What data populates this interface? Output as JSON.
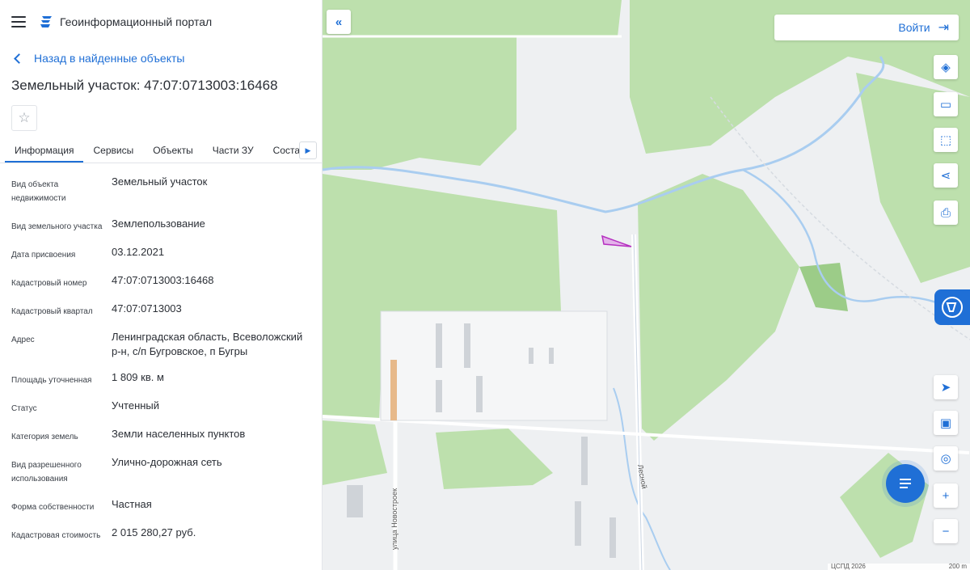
{
  "header": {
    "app_title": "Геоинформационный портал"
  },
  "nav": {
    "back_label": "Назад в найденные объекты"
  },
  "object": {
    "title": "Земельный участок: 47:07:0713003:16468"
  },
  "tabs": [
    {
      "label": "Информация",
      "active": true
    },
    {
      "label": "Сервисы"
    },
    {
      "label": "Объекты"
    },
    {
      "label": "Части ЗУ"
    },
    {
      "label": "Соста"
    }
  ],
  "properties": [
    {
      "label": "Вид объекта недвижимости",
      "value": "Земельный участок"
    },
    {
      "label": "Вид земельного участка",
      "value": "Землепользование"
    },
    {
      "label": "Дата присвоения",
      "value": "03.12.2021"
    },
    {
      "label": "Кадастровый номер",
      "value": "47:07:0713003:16468"
    },
    {
      "label": "Кадастровый квартал",
      "value": "47:07:0713003"
    },
    {
      "label": "Адрес",
      "value": "Ленинградская область, Всеволожский р-н, с/п Бугровское, п Бугры"
    },
    {
      "label": "Площадь уточненная",
      "value": "1 809 кв. м"
    },
    {
      "label": "Статус",
      "value": "Учтенный"
    },
    {
      "label": "Категория земель",
      "value": "Земли населенных пунктов"
    },
    {
      "label": "Вид разрешенного использования",
      "value": "Улично-дорожная сеть"
    },
    {
      "label": "Форма собственности",
      "value": "Частная"
    },
    {
      "label": "Кадастровая стоимость",
      "value": "2 015 280,27 руб."
    }
  ],
  "map": {
    "login_label": "Войти",
    "street_label_1": "улица Новостроек",
    "street_label_2": "Лесной",
    "attribution": "ЦСПД 2026",
    "scale_label": "200 m",
    "colors": {
      "forest": "#bde0ad",
      "water": "#a9cdf0",
      "parcel": "#b530c0",
      "accent": "#1f6fd6"
    }
  },
  "icons": {
    "collapse": "double-chevron-left-icon",
    "layers": "layers-icon",
    "ruler": "ruler-icon",
    "select": "select-area-icon",
    "share": "share-icon",
    "print": "print-icon",
    "location": "navigation-arrow-icon",
    "window": "picture-in-picture-icon",
    "geo": "geo-search-icon",
    "zoom_in": "plus-icon",
    "zoom_out": "minus-icon",
    "chat": "chat-icon"
  }
}
